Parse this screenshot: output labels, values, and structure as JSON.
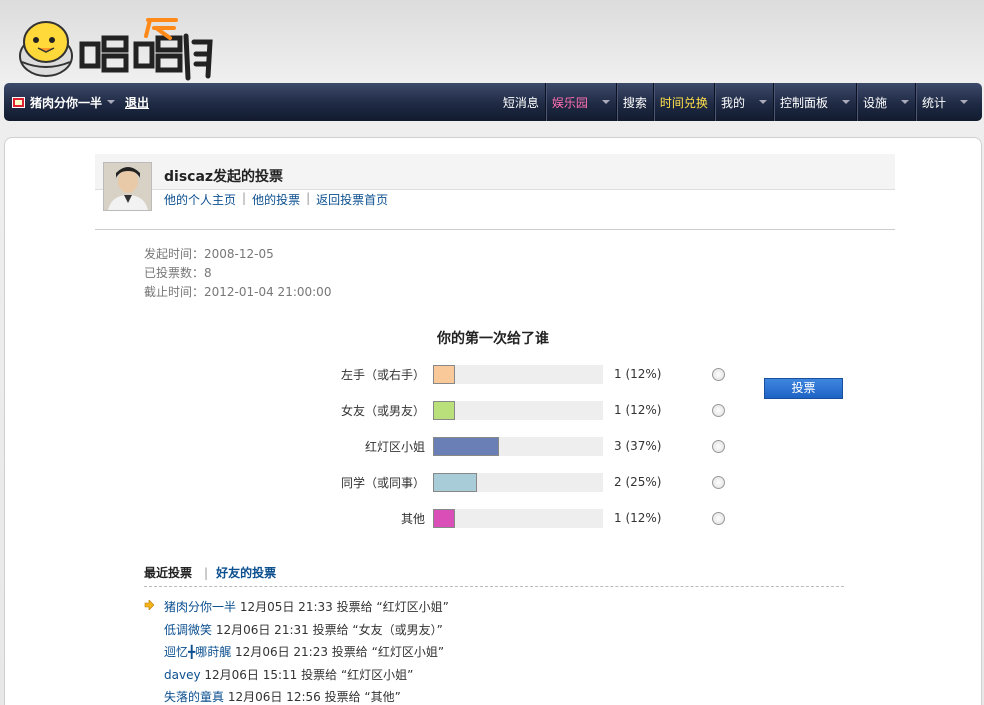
{
  "nav": {
    "user": "猪肉分你一半",
    "logout": "退出",
    "items": [
      {
        "label": "短消息",
        "style": "normal",
        "caret": false
      },
      {
        "label": "娱乐园",
        "style": "pink",
        "caret": true
      },
      {
        "label": "搜索",
        "style": "normal",
        "caret": false
      },
      {
        "label": "时间兑换",
        "style": "yellow",
        "caret": false
      },
      {
        "label": "我的",
        "style": "normal",
        "caret": true
      },
      {
        "label": "控制面板",
        "style": "normal",
        "caret": true
      },
      {
        "label": "设施",
        "style": "normal",
        "caret": true
      },
      {
        "label": "统计",
        "style": "normal",
        "caret": true
      }
    ]
  },
  "poll": {
    "title": "discaz发起的投票",
    "links": [
      "他的个人主页",
      "他的投票",
      "返回投票首页"
    ],
    "meta": {
      "start": "发起时间：2008-12-05",
      "count": "已投票数：8",
      "end": "截止时间：2012-01-04 21:00:00"
    },
    "question": "你的第一次给了谁",
    "options": [
      {
        "label": "左手（或右手）",
        "result": "1 (12%)",
        "fraction": 0.125,
        "color": "#f9c99a"
      },
      {
        "label": "女友（或男友）",
        "result": "1 (12%)",
        "fraction": 0.125,
        "color": "#b9e07a"
      },
      {
        "label": "红灯区小姐",
        "result": "3 (37%)",
        "fraction": 0.375,
        "color": "#6a7fb6"
      },
      {
        "label": "同学（或同事）",
        "result": "2 (25%)",
        "fraction": 0.25,
        "color": "#a8ccd8"
      },
      {
        "label": "其他",
        "result": "1 (12%)",
        "fraction": 0.125,
        "color": "#d94fb7"
      }
    ],
    "vote_button": "投票"
  },
  "recent": {
    "tab_active": "最近投票",
    "tab_other": "好友的投票",
    "entries": [
      {
        "name": "猪肉分你一半",
        "text": " 12月05日 21:33 投票给 “红灯区小姐”",
        "arrow": true
      },
      {
        "name": "低调微笑",
        "text": " 12月06日 21:31 投票给 “女友（或男友）”",
        "arrow": false
      },
      {
        "name": "迴忆╋哪莳艉",
        "text": " 12月06日 21:23 投票给 “红灯区小姐”",
        "arrow": false
      },
      {
        "name": "davey",
        "text": " 12月06日 15:11 投票给 “红灯区小姐”",
        "arrow": false
      },
      {
        "name": "失落的童真",
        "text": " 12月06日 12:56 投票给 “其他”",
        "arrow": false
      }
    ]
  }
}
